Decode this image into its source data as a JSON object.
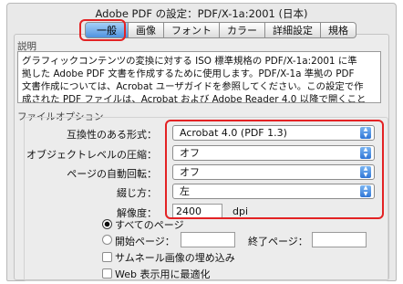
{
  "window": {
    "title": "Adobe PDF の設定：PDF/X-1a:2001 (日本)"
  },
  "tabs": [
    {
      "label": "一般",
      "active": true
    },
    {
      "label": "画像",
      "active": false
    },
    {
      "label": "フォント",
      "active": false
    },
    {
      "label": "カラー",
      "active": false
    },
    {
      "label": "詳細設定",
      "active": false
    },
    {
      "label": "規格",
      "active": false
    }
  ],
  "description": {
    "label": "説明",
    "lines": [
      "グラフィックコンテンツの変換に対する ISO 標準規格の PDF/X-1a:2001 に準",
      "拠した Adobe PDF 文書を作成するために使用します。PDF/X-1a 準拠の PDF",
      "文書作成については、Acrobat ユーザガイドを参照してください。この設定で作",
      "成された PDF ファイルは、Acrobat および Adobe Reader 4.0 以降で開くこと"
    ]
  },
  "file_options": {
    "label": "ファイルオプション",
    "compatibility": {
      "label": "互換性のある形式：",
      "value": "Acrobat 4.0 (PDF 1.3)"
    },
    "object_compression": {
      "label": "オブジェクトレベルの圧縮：",
      "value": "オフ"
    },
    "auto_rotate": {
      "label": "ページの自動回転：",
      "value": "オフ"
    },
    "binding": {
      "label": "綴じ方：",
      "value": "左"
    },
    "resolution": {
      "label": "解像度：",
      "value": "2400",
      "unit": "dpi"
    },
    "pages_all": {
      "label": "すべてのページ",
      "selected": true
    },
    "pages_range": {
      "start_label": "開始ページ：",
      "end_label": "終了ページ：",
      "start_value": "",
      "end_value": "",
      "selected": false
    },
    "embed_thumbnails": {
      "label": "サムネール画像の埋め込み",
      "checked": false
    },
    "fast_web_view": {
      "label": "Web 表示用に最適化",
      "checked": false
    }
  },
  "colors": {
    "highlight": "#e32224",
    "accent": "#4f93e0"
  }
}
